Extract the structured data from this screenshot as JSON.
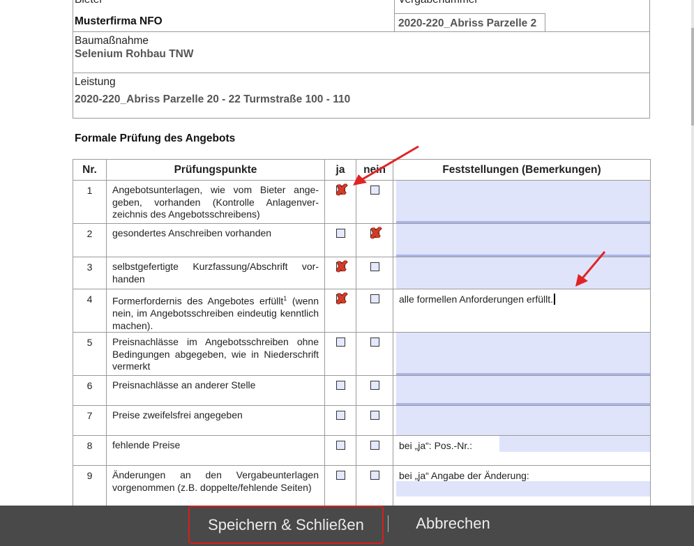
{
  "header": {
    "bieter_label": "Bieter",
    "bieter_value": "Musterfirma NFO",
    "vergabenummer_label": "Vergabenummer",
    "vergabenummer_value": "2020-220_Abriss Parzelle 2",
    "baumassnahme_label": "Baumaßnahme",
    "baumassnahme_value": "Selenium Rohbau TNW",
    "leistung_label": "Leistung",
    "leistung_value": "2020-220_Abriss Parzelle 20 - 22 Turmstraße 100 - 110"
  },
  "section_title": "Formale Prüfung des Angebots",
  "table": {
    "columns": {
      "nr": "Nr.",
      "punkte": "Prüfungspunkte",
      "ja": "ja",
      "nein": "nein",
      "feststellungen": "Feststellungen (Bemerkungen)"
    },
    "rows": [
      {
        "nr": "1",
        "text": "Angebotsunterlagen, wie vom Bieter ange­geben, vorhanden (Kontrolle Anlagenver­zeichnis des Angebotsschreibens)",
        "ja": true,
        "nein": false,
        "remark": ""
      },
      {
        "nr": "2",
        "text": "gesondertes Anschreiben vorhanden",
        "ja": false,
        "nein": true,
        "remark": ""
      },
      {
        "nr": "3",
        "text": "selbstgefertigte Kurzfassung/Abschrift vor­handen",
        "ja": true,
        "nein": false,
        "remark": ""
      },
      {
        "nr": "4",
        "text": "Formerfordernis des Angebotes erfüllt",
        "footnote": "1",
        "text2": " (wenn nein, im Angebotsschreiben eindeutig kenntlich machen).",
        "ja": true,
        "nein": false,
        "remark": "alle formellen Anforderungen erfüllt."
      },
      {
        "nr": "5",
        "text": "Preisnachlässe im Angebotsschreiben ohne Bedingungen abgegeben, wie in Nieder­schrift vermerkt",
        "ja": false,
        "nein": false,
        "remark": ""
      },
      {
        "nr": "6",
        "text": "Preisnachlässe an anderer Stelle",
        "ja": false,
        "nein": false,
        "remark": ""
      },
      {
        "nr": "7",
        "text": "Preise zweifelsfrei angegeben",
        "ja": false,
        "nein": false,
        "remark": ""
      },
      {
        "nr": "8",
        "text": "fehlende Preise",
        "ja": false,
        "nein": false,
        "remark": "bei „ja“: Pos.-Nr.:"
      },
      {
        "nr": "9",
        "text": "Änderungen an den Vergabeunterlagen vorgenommen (z.B. doppelte/fehlende Sei­ten)",
        "ja": false,
        "nein": false,
        "remark": "bei „ja“ Angabe der Änderung:"
      }
    ]
  },
  "footer": {
    "save_label": "Speichern & Schließen",
    "cancel_label": "Abbrechen"
  },
  "colors": {
    "form_fill": "#dfe4fb",
    "check_mark": "#d83a25",
    "annotation_arrow": "#e02424",
    "save_border": "#d41f1f",
    "bottom_bar": "#494949"
  }
}
